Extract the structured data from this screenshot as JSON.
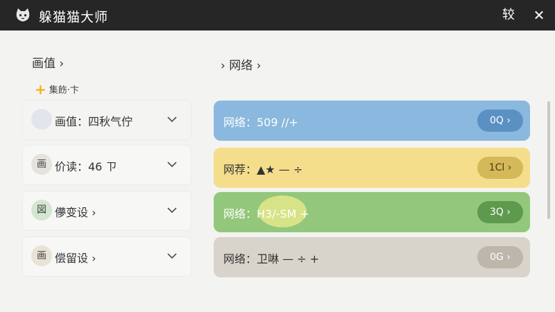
{
  "window": {
    "title": "躲猫猫大师",
    "extra_button": "较",
    "close_glyph": "✕"
  },
  "left_panel": {
    "heading": "画值 ›",
    "add_filter_label": "集飭·卞",
    "items": [
      {
        "icon_text": "",
        "label": "画值：四秋气佇"
      },
      {
        "icon_text": "画",
        "label": "价读：46 ㄗ"
      },
      {
        "icon_text": "図",
        "label": "儚变设 ›"
      },
      {
        "icon_text": "画",
        "label": "偿留设 ›"
      }
    ]
  },
  "right_panel": {
    "heading": "› 网络 ›",
    "rows": [
      {
        "label": "网络：509 //+",
        "button": "0Q ›"
      },
      {
        "label": "网荐：▲★ — ÷",
        "button": "1Cl ›"
      },
      {
        "label": "网络：H3/-SM +",
        "button": "3Q ›"
      },
      {
        "label": "网络：卫啉 — ÷ +",
        "button": "0G ›"
      }
    ]
  },
  "colors": {
    "title_bar": "#262626",
    "blue_row": "#8bb8de",
    "blue_button": "#5a90c2",
    "yellow_row": "#f4de8c",
    "yellow_button": "#d4b85a",
    "green_row": "#93c77c",
    "green_button": "#5e9a4e",
    "gray_row": "#d8d3cb",
    "gray_button": "#bdb6ab"
  },
  "icons": {
    "app": "cat-face-icon",
    "chevron": "chevron-down-icon",
    "add": "plus-icon"
  }
}
